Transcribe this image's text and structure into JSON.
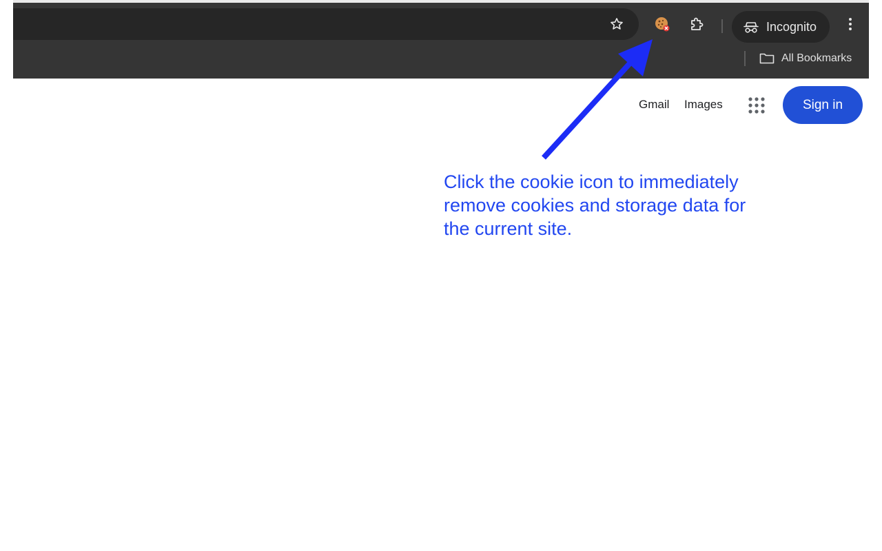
{
  "toolbar": {
    "incognito_label": "Incognito",
    "icons": [
      "star-icon",
      "cookie-icon",
      "extensions-icon",
      "incognito-icon",
      "more-vert-icon"
    ]
  },
  "bookmarks_bar": {
    "all_bookmarks_label": "All Bookmarks"
  },
  "google_header": {
    "gmail_label": "Gmail",
    "images_label": "Images",
    "sign_in_label": "Sign in"
  },
  "annotation": {
    "text": "Click the cookie icon to immediately remove cookies and storage data for the current site."
  },
  "colors": {
    "chrome_bg": "#353535",
    "omnibox_bg": "#262626",
    "sign_in_blue": "#2150d6",
    "annotation_blue": "#2247f0"
  }
}
